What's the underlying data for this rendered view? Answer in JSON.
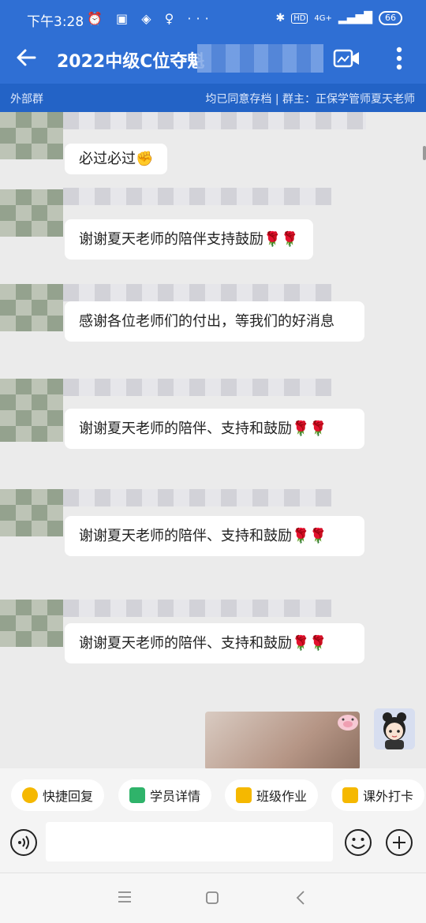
{
  "status": {
    "time": "下午3:28",
    "net_label": "4G+",
    "battery": "66"
  },
  "header": {
    "title": "2022中级C位夺魁",
    "back_icon": "arrow-left-icon",
    "video_icon": "video-camera-icon",
    "more_icon": "more-vertical-icon"
  },
  "subheader": {
    "tag": "外部群",
    "info": "均已同意存档 | 群主：正保学管师夏天老师"
  },
  "messages": [
    {
      "text": "必过必过✊"
    },
    {
      "text": "谢谢夏天老师的陪伴支持鼓励🌹🌹"
    },
    {
      "text": "感谢各位老师们的付出，等我们的好消息"
    },
    {
      "text": "谢谢夏天老师的陪伴、支持和鼓励🌹🌹"
    },
    {
      "text": "谢谢夏天老师的陪伴、支持和鼓励🌹🌹"
    },
    {
      "text": "谢谢夏天老师的陪伴、支持和鼓励🌹🌹"
    }
  ],
  "quick_actions": [
    {
      "label": "快捷回复",
      "icon": "quick-reply-icon",
      "color": "#f5b800"
    },
    {
      "label": "学员详情",
      "icon": "student-icon",
      "color": "#2fb36a"
    },
    {
      "label": "班级作业",
      "icon": "homework-icon",
      "color": "#f5b800"
    },
    {
      "label": "课外打卡",
      "icon": "checkin-icon",
      "color": "#f5b800"
    }
  ],
  "input": {
    "placeholder": ""
  },
  "colors": {
    "header": "#2f6fd4",
    "subheader": "#2363c6",
    "chat_bg": "#ebebeb"
  }
}
